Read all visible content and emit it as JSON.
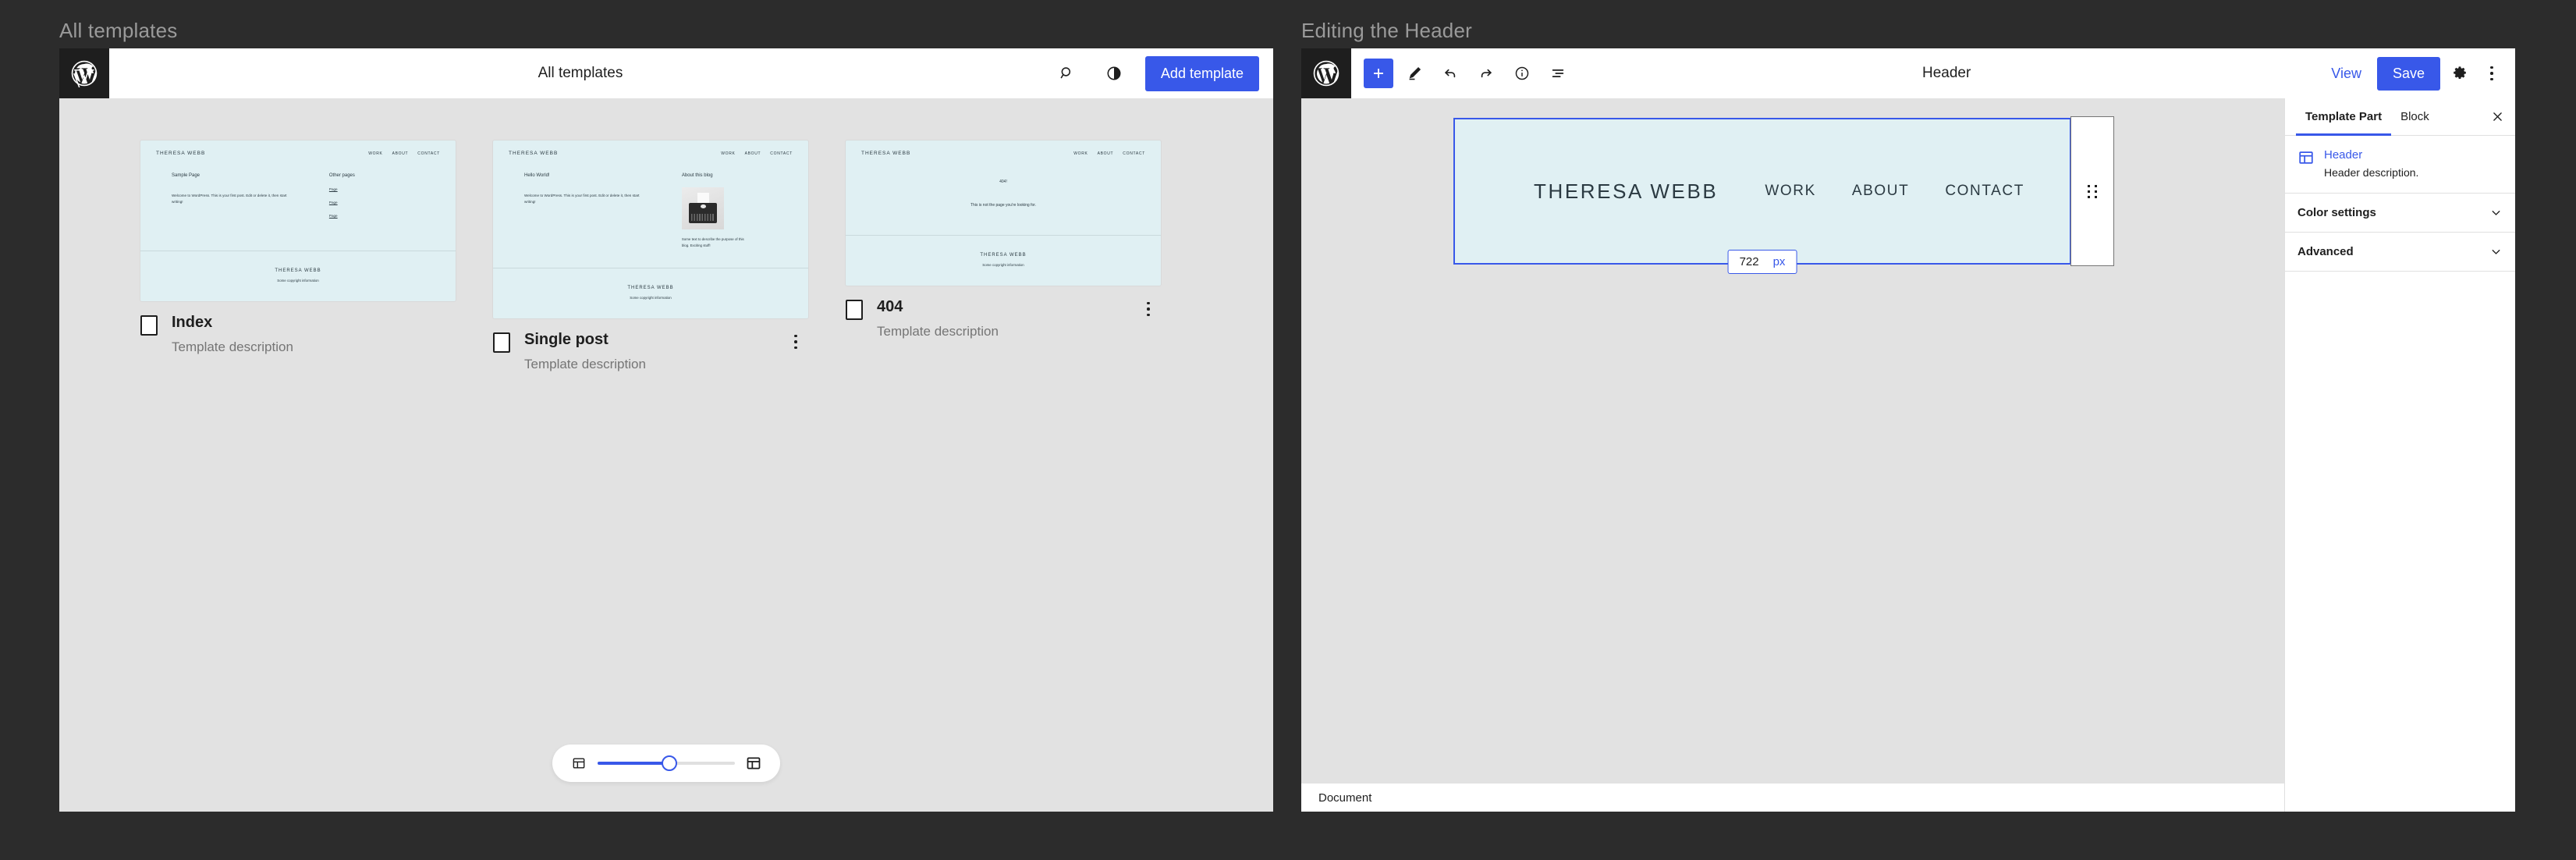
{
  "left_panel": {
    "caption": "All templates",
    "header": {
      "title": "All templates",
      "logo_icon": "wordpress-logo-icon",
      "search_icon": "search-icon",
      "contrast_icon": "contrast-toggle-icon",
      "add_template_label": "Add template"
    },
    "templates": [
      {
        "name": "Index",
        "description": "Template description",
        "preview": {
          "brand": "THERESA WEBB",
          "nav": [
            "WORK",
            "ABOUT",
            "CONTACT"
          ],
          "heading": "Sample Page",
          "body": "Welcome to WordPress. This is your first post. Edit or delete it, then start writing!",
          "aside_title": "Other pages",
          "aside_links": [
            "Page",
            "Page",
            "Page"
          ],
          "footer_brand": "THERESA WEBB",
          "footer_note": "Some copyright information"
        }
      },
      {
        "name": "Single post",
        "description": "Template description",
        "preview": {
          "brand": "THERESA WEBB",
          "nav": [
            "WORK",
            "ABOUT",
            "CONTACT"
          ],
          "heading": "Hello World!",
          "body": "Welcome to WordPress. This is your first post. Edit or delete it, then start writing!",
          "aside_title": "About this blog",
          "aside_image": "typewriter-photo",
          "aside_caption": "Some text to describe the purpose of this blog. Exciting stuff!",
          "footer_brand": "THERESA WEBB",
          "footer_note": "Some copyright information"
        }
      },
      {
        "name": "404",
        "description": "Template description",
        "preview": {
          "brand": "THERESA WEBB",
          "nav": [
            "WORK",
            "ABOUT",
            "CONTACT"
          ],
          "heading": "404!",
          "body": "This is not the page you're looking for.",
          "footer_brand": "THERESA WEBB",
          "footer_note": "Some copyright information"
        }
      }
    ],
    "zoom_control": {
      "small_icon": "layout-small-icon",
      "large_icon": "layout-large-icon",
      "value_percent": 52
    }
  },
  "right_panel": {
    "caption": "Editing the Header",
    "header": {
      "title": "Header",
      "logo_icon": "wordpress-logo-icon",
      "tools": [
        {
          "icon": "plus-icon",
          "name": "add-block"
        },
        {
          "icon": "pencil-icon",
          "name": "edit-tool"
        },
        {
          "icon": "undo-icon",
          "name": "undo"
        },
        {
          "icon": "redo-icon",
          "name": "redo"
        },
        {
          "icon": "info-icon",
          "name": "details"
        },
        {
          "icon": "list-view-icon",
          "name": "list-view"
        }
      ],
      "view_label": "View",
      "save_label": "Save",
      "settings_icon": "gear-icon",
      "more_icon": "kebab-menu-icon"
    },
    "canvas": {
      "block": {
        "brand": "THERESA WEBB",
        "nav": [
          "WORK",
          "ABOUT",
          "CONTACT"
        ],
        "drag_handle_icon": "drag-handle-icon"
      },
      "size_tooltip": {
        "value": "722",
        "unit": "px"
      }
    },
    "status_bar": {
      "label": "Document"
    },
    "sidebar": {
      "tabs": [
        {
          "label": "Template Part",
          "active": true
        },
        {
          "label": "Block",
          "active": false
        }
      ],
      "close_icon": "close-icon",
      "block_info": {
        "icon": "template-part-icon",
        "name": "Header",
        "description": "Header description."
      },
      "sections": [
        {
          "label": "Color settings",
          "chevron": "chevron-down-icon"
        },
        {
          "label": "Advanced",
          "chevron": "chevron-down-icon"
        }
      ]
    }
  },
  "colors": {
    "accent": "#3858e9",
    "dark_bg": "#2c2c2c",
    "canvas_bg": "#e2e2e2",
    "preview_bg": "#e0f0f3"
  }
}
